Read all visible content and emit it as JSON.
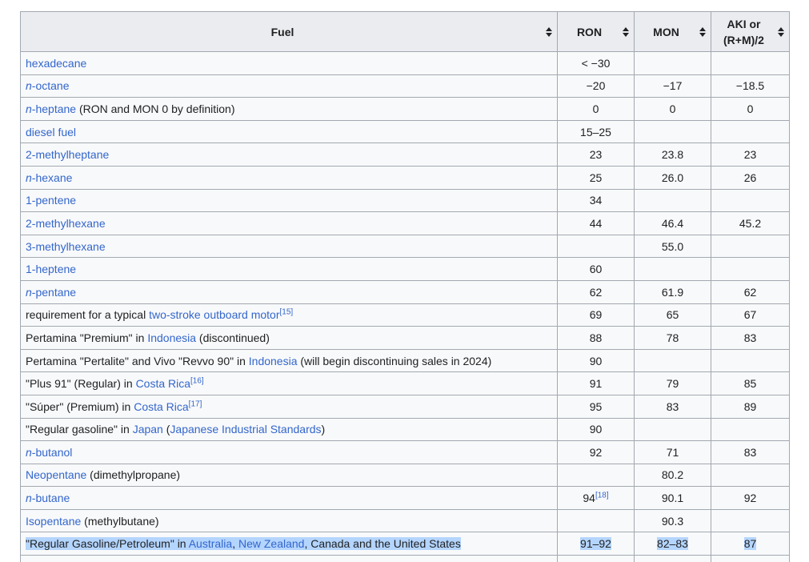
{
  "headers": {
    "fuel": "Fuel",
    "ron": "RON",
    "mon": "MON",
    "aki_line1": "AKI or",
    "aki_line2": "(R+M)/2"
  },
  "rows": [
    {
      "pre": "",
      "link1_italic": "",
      "link1": "hexadecane",
      "mid": "",
      "link2": "",
      "mid2": "",
      "link3": "",
      "post": "",
      "sup": "",
      "ron": "< −30",
      "ron_sup": "",
      "mon": "",
      "aki": ""
    },
    {
      "pre": "",
      "link1_italic": "n",
      "link1": "-octane",
      "mid": "",
      "link2": "",
      "mid2": "",
      "link3": "",
      "post": "",
      "sup": "",
      "ron": "−20",
      "ron_sup": "",
      "mon": "−17",
      "aki": "−18.5"
    },
    {
      "pre": "",
      "link1_italic": "n",
      "link1": "-heptane",
      "mid": " (RON and MON 0 by definition)",
      "link2": "",
      "mid2": "",
      "link3": "",
      "post": "",
      "sup": "",
      "ron": "0",
      "ron_sup": "",
      "mon": "0",
      "aki": "0"
    },
    {
      "pre": "",
      "link1_italic": "",
      "link1": "diesel fuel",
      "mid": "",
      "link2": "",
      "mid2": "",
      "link3": "",
      "post": "",
      "sup": "",
      "ron": "15–25",
      "ron_sup": "",
      "mon": "",
      "aki": ""
    },
    {
      "pre": "",
      "link1_italic": "",
      "link1": "2-methylheptane",
      "mid": "",
      "link2": "",
      "mid2": "",
      "link3": "",
      "post": "",
      "sup": "",
      "ron": "23",
      "ron_sup": "",
      "mon": "23.8",
      "aki": "23"
    },
    {
      "pre": "",
      "link1_italic": "n",
      "link1": "-hexane",
      "mid": "",
      "link2": "",
      "mid2": "",
      "link3": "",
      "post": "",
      "sup": "",
      "ron": "25",
      "ron_sup": "",
      "mon": "26.0",
      "aki": "26"
    },
    {
      "pre": "",
      "link1_italic": "",
      "link1": "1-pentene",
      "mid": "",
      "link2": "",
      "mid2": "",
      "link3": "",
      "post": "",
      "sup": "",
      "ron": "34",
      "ron_sup": "",
      "mon": "",
      "aki": ""
    },
    {
      "pre": "",
      "link1_italic": "",
      "link1": "2-methylhexane",
      "mid": "",
      "link2": "",
      "mid2": "",
      "link3": "",
      "post": "",
      "sup": "",
      "ron": "44",
      "ron_sup": "",
      "mon": "46.4",
      "aki": "45.2"
    },
    {
      "pre": "",
      "link1_italic": "",
      "link1": "3-methylhexane",
      "mid": "",
      "link2": "",
      "mid2": "",
      "link3": "",
      "post": "",
      "sup": "",
      "ron": "",
      "ron_sup": "",
      "mon": "55.0",
      "aki": ""
    },
    {
      "pre": "",
      "link1_italic": "",
      "link1": "1-heptene",
      "mid": "",
      "link2": "",
      "mid2": "",
      "link3": "",
      "post": "",
      "sup": "",
      "ron": "60",
      "ron_sup": "",
      "mon": "",
      "aki": ""
    },
    {
      "pre": "",
      "link1_italic": "n",
      "link1": "-pentane",
      "mid": "",
      "link2": "",
      "mid2": "",
      "link3": "",
      "post": "",
      "sup": "",
      "ron": "62",
      "ron_sup": "",
      "mon": "61.9",
      "aki": "62"
    },
    {
      "pre": "requirement for a typical ",
      "link1_italic": "",
      "link1": "two-stroke outboard motor",
      "mid": "",
      "link2": "",
      "mid2": "",
      "link3": "",
      "post": "",
      "sup": "[15]",
      "ron": "69",
      "ron_sup": "",
      "mon": "65",
      "aki": "67"
    },
    {
      "pre": "Pertamina \"Premium\" in ",
      "link1_italic": "",
      "link1": "Indonesia",
      "mid": " (discontinued)",
      "link2": "",
      "mid2": "",
      "link3": "",
      "post": "",
      "sup": "",
      "ron": "88",
      "ron_sup": "",
      "mon": "78",
      "aki": "83"
    },
    {
      "pre": "Pertamina \"Pertalite\" and Vivo \"Revvo 90\" in ",
      "link1_italic": "",
      "link1": "Indonesia",
      "mid": " (will begin discontinuing sales in 2024)",
      "link2": "",
      "mid2": "",
      "link3": "",
      "post": "",
      "sup": "",
      "ron": "90",
      "ron_sup": "",
      "mon": "",
      "aki": ""
    },
    {
      "pre": "\"Plus 91\" (Regular) in ",
      "link1_italic": "",
      "link1": "Costa Rica",
      "mid": "",
      "link2": "",
      "mid2": "",
      "link3": "",
      "post": "",
      "sup": "[16]",
      "ron": "91",
      "ron_sup": "",
      "mon": "79",
      "aki": "85"
    },
    {
      "pre": "\"Súper\" (Premium) in ",
      "link1_italic": "",
      "link1": "Costa Rica",
      "mid": "",
      "link2": "",
      "mid2": "",
      "link3": "",
      "post": "",
      "sup": "[17]",
      "ron": "95",
      "ron_sup": "",
      "mon": "83",
      "aki": "89"
    },
    {
      "pre": "\"Regular gasoline\" in ",
      "link1_italic": "",
      "link1": "Japan",
      "mid": " (",
      "link2": "Japanese Industrial Standards",
      "mid2": ")",
      "link3": "",
      "post": "",
      "sup": "",
      "ron": "90",
      "ron_sup": "",
      "mon": "",
      "aki": ""
    },
    {
      "pre": "",
      "link1_italic": "n",
      "link1": "-butanol",
      "mid": "",
      "link2": "",
      "mid2": "",
      "link3": "",
      "post": "",
      "sup": "",
      "ron": "92",
      "ron_sup": "",
      "mon": "71",
      "aki": "83"
    },
    {
      "pre": "",
      "link1_italic": "",
      "link1": "Neopentane",
      "mid": " (dimethylpropane)",
      "link2": "",
      "mid2": "",
      "link3": "",
      "post": "",
      "sup": "",
      "ron": "",
      "ron_sup": "",
      "mon": "80.2",
      "aki": ""
    },
    {
      "pre": "",
      "link1_italic": "n",
      "link1": "-butane",
      "mid": "",
      "link2": "",
      "mid2": "",
      "link3": "",
      "post": "",
      "sup": "",
      "ron": "94",
      "ron_sup": "[18]",
      "mon": "90.1",
      "aki": "92"
    },
    {
      "pre": "",
      "link1_italic": "",
      "link1": "Isopentane",
      "mid": " (methylbutane)",
      "link2": "",
      "mid2": "",
      "link3": "",
      "post": "",
      "sup": "",
      "ron": "",
      "ron_sup": "",
      "mon": "90.3",
      "aki": ""
    },
    {
      "pre": "\"Regular Gasoline/Petroleum\" in ",
      "link1_italic": "",
      "link1": "Australia",
      "mid": ", ",
      "link2": "New Zealand",
      "mid2": ", Canada and the United States",
      "link3": "",
      "post": "",
      "sup": "",
      "ron": "91–92",
      "ron_sup": "",
      "mon": "82–83",
      "aki": "87",
      "highlighted": true
    }
  ],
  "colors": {
    "link": "#3366cc",
    "header_bg": "#eaecf0",
    "cell_bg": "#f8f9fa",
    "border": "#a2a9b1",
    "selection": "#b4d5fe"
  },
  "icons": {
    "sort": "sort-arrows-icon"
  }
}
